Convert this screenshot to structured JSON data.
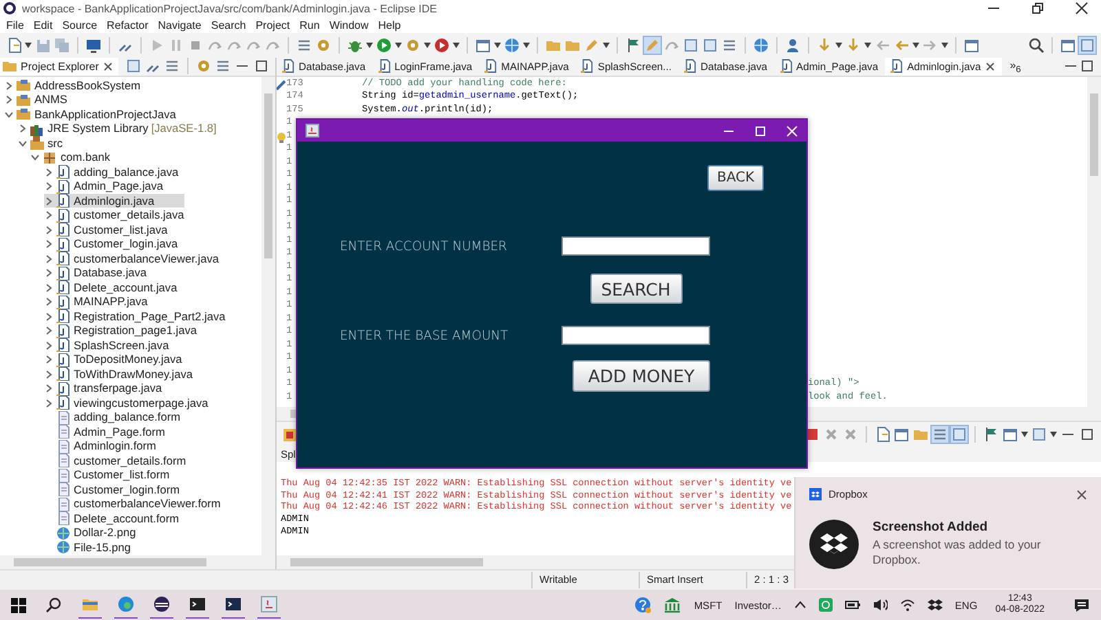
{
  "window": {
    "title": "workspace - BankApplicationProjectJava/src/com/bank/Adminlogin.java - Eclipse IDE"
  },
  "menu": [
    "File",
    "Edit",
    "Source",
    "Refactor",
    "Navigate",
    "Search",
    "Project",
    "Run",
    "Window",
    "Help"
  ],
  "project_explorer": {
    "title": "Project Explorer",
    "tree": [
      {
        "label": "AddressBookSystem",
        "kind": "project",
        "expanded": false,
        "selected": false
      },
      {
        "label": "ANMS",
        "kind": "project",
        "expanded": false,
        "selected": false
      },
      {
        "label": "BankApplicationProjectJava",
        "kind": "project",
        "expanded": true,
        "selected": false,
        "children": [
          {
            "label": "JRE System Library",
            "decoration": "[JavaSE-1.8]",
            "kind": "library",
            "expanded": false,
            "selected": false
          },
          {
            "label": "src",
            "kind": "source",
            "expanded": true,
            "selected": false,
            "children": [
              {
                "label": "com.bank",
                "kind": "package",
                "expanded": true,
                "selected": false,
                "children": [
                  {
                    "label": "adding_balance.java",
                    "kind": "java",
                    "expanded": false,
                    "selected": false
                  },
                  {
                    "label": "Admin_Page.java",
                    "kind": "java",
                    "expanded": false,
                    "selected": false
                  },
                  {
                    "label": "Adminlogin.java",
                    "kind": "java",
                    "expanded": false,
                    "selected": true
                  },
                  {
                    "label": "customer_details.java",
                    "kind": "java",
                    "expanded": false,
                    "selected": false
                  },
                  {
                    "label": "Customer_list.java",
                    "kind": "java",
                    "expanded": false,
                    "selected": false
                  },
                  {
                    "label": "Customer_login.java",
                    "kind": "java",
                    "expanded": false,
                    "selected": false
                  },
                  {
                    "label": "customerbalanceViewer.java",
                    "kind": "java",
                    "expanded": false,
                    "selected": false
                  },
                  {
                    "label": "Database.java",
                    "kind": "java",
                    "expanded": false,
                    "selected": false
                  },
                  {
                    "label": "Delete_account.java",
                    "kind": "java",
                    "expanded": false,
                    "selected": false
                  },
                  {
                    "label": "MAINAPP.java",
                    "kind": "java",
                    "expanded": false,
                    "selected": false
                  },
                  {
                    "label": "Registration_Page_Part2.java",
                    "kind": "java",
                    "expanded": false,
                    "selected": false
                  },
                  {
                    "label": "Registration_page1.java",
                    "kind": "java",
                    "expanded": false,
                    "selected": false
                  },
                  {
                    "label": "SplashScreen.java",
                    "kind": "java",
                    "expanded": false,
                    "selected": false
                  },
                  {
                    "label": "ToDepositMoney.java",
                    "kind": "java",
                    "expanded": false,
                    "selected": false
                  },
                  {
                    "label": "ToWithDrawMoney.java",
                    "kind": "java",
                    "expanded": false,
                    "selected": false
                  },
                  {
                    "label": "transferpage.java",
                    "kind": "java",
                    "expanded": false,
                    "selected": false
                  },
                  {
                    "label": "viewingcustomerpage.java",
                    "kind": "java",
                    "expanded": false,
                    "selected": false
                  },
                  {
                    "label": "adding_balance.form",
                    "kind": "form",
                    "selected": false
                  },
                  {
                    "label": "Admin_Page.form",
                    "kind": "form",
                    "selected": false
                  },
                  {
                    "label": "Adminlogin.form",
                    "kind": "form",
                    "selected": false
                  },
                  {
                    "label": "customer_details.form",
                    "kind": "form",
                    "selected": false
                  },
                  {
                    "label": "Customer_list.form",
                    "kind": "form",
                    "selected": false
                  },
                  {
                    "label": "Customer_login.form",
                    "kind": "form",
                    "selected": false
                  },
                  {
                    "label": "customerbalanceViewer.form",
                    "kind": "form",
                    "selected": false
                  },
                  {
                    "label": "Delete_account.form",
                    "kind": "form",
                    "selected": false
                  },
                  {
                    "label": "Dollar-2.png",
                    "kind": "image",
                    "selected": false
                  },
                  {
                    "label": "File-15.png",
                    "kind": "image",
                    "selected": false
                  }
                ]
              }
            ]
          }
        ]
      }
    ]
  },
  "editor": {
    "tabs": [
      {
        "label": "Database.java",
        "selected": false
      },
      {
        "label": "LoginFrame.java",
        "selected": false
      },
      {
        "label": "MAINAPP.java",
        "selected": false
      },
      {
        "label": "SplashScreen...",
        "selected": false
      },
      {
        "label": "Database.java",
        "selected": false
      },
      {
        "label": "Admin_Page.java",
        "selected": false
      },
      {
        "label": "Adminlogin.java",
        "selected": true
      }
    ],
    "overflow": "»$_{6}$",
    "lines": [
      {
        "number": "173",
        "segments": [
          {
            "text": "// TODO add your handling code here:",
            "kind": "comment"
          }
        ]
      },
      {
        "number": "174",
        "segments": [
          {
            "text": "String id=",
            "kind": "plain"
          },
          {
            "text": "getadmin_username",
            "kind": "field"
          },
          {
            "text": ".getText();",
            "kind": "plain"
          }
        ]
      },
      {
        "number": "175",
        "segments": [
          {
            "text": "System.",
            "kind": "plain"
          },
          {
            "text": "out",
            "kind": "static"
          },
          {
            "text": ".println(id);",
            "kind": "plain"
          }
        ]
      },
      {
        "number": "1"
      },
      {
        "number": "1"
      },
      {
        "number": "1"
      },
      {
        "number": "1"
      },
      {
        "number": "1"
      },
      {
        "number": "1"
      },
      {
        "number": "1"
      },
      {
        "number": "1"
      },
      {
        "number": "1"
      },
      {
        "number": "1"
      },
      {
        "number": "1"
      },
      {
        "number": "1"
      },
      {
        "number": "1"
      },
      {
        "number": "1"
      },
      {
        "number": "1"
      },
      {
        "number": "1"
      },
      {
        "number": "1"
      },
      {
        "number": "1"
      },
      {
        "number": "1"
      },
      {
        "number": "1"
      },
      {
        "number": "1",
        "covered": true,
        "segments": [
          {
            "text": "ional) \">",
            "kind": "comment"
          }
        ]
      },
      {
        "number": "1",
        "covered": true,
        "segments": [
          {
            "text": "look and feel.",
            "kind": "comment"
          }
        ]
      }
    ]
  },
  "console": {
    "tab": "Spl",
    "lines": [
      {
        "text": "Thu Aug 04 12:42:35 IST 2022 WARN: Establishing SSL connection without server's identity ve",
        "kind": "error"
      },
      {
        "text": "Thu Aug 04 12:42:41 IST 2022 WARN: Establishing SSL connection without server's identity ve",
        "kind": "error"
      },
      {
        "text": "Thu Aug 04 12:42:46 IST 2022 WARN: Establishing SSL connection without server's identity ve",
        "kind": "error"
      },
      {
        "text": "ADMIN",
        "kind": "output"
      },
      {
        "text": "ADMIN",
        "kind": "output"
      }
    ]
  },
  "status_bar": [
    "Writable",
    "Smart Insert",
    "2 : 1 : 3"
  ],
  "dialog": {
    "back_button": "BACK",
    "rows": [
      {
        "label": "ENTER ACCOUNT NUMBER",
        "button": "SEARCH"
      },
      {
        "label": "ENTER THE BASE AMOUNT",
        "button": "ADD MONEY"
      }
    ]
  },
  "notification": {
    "app": "Dropbox",
    "title": "Screenshot Added",
    "message": "A screenshot was added to your Dropbox."
  },
  "taskbar": {
    "tray": [
      "MSFT",
      "Investor…"
    ],
    "language": "ENG",
    "time": "12:43",
    "date": "04-08-2022"
  }
}
